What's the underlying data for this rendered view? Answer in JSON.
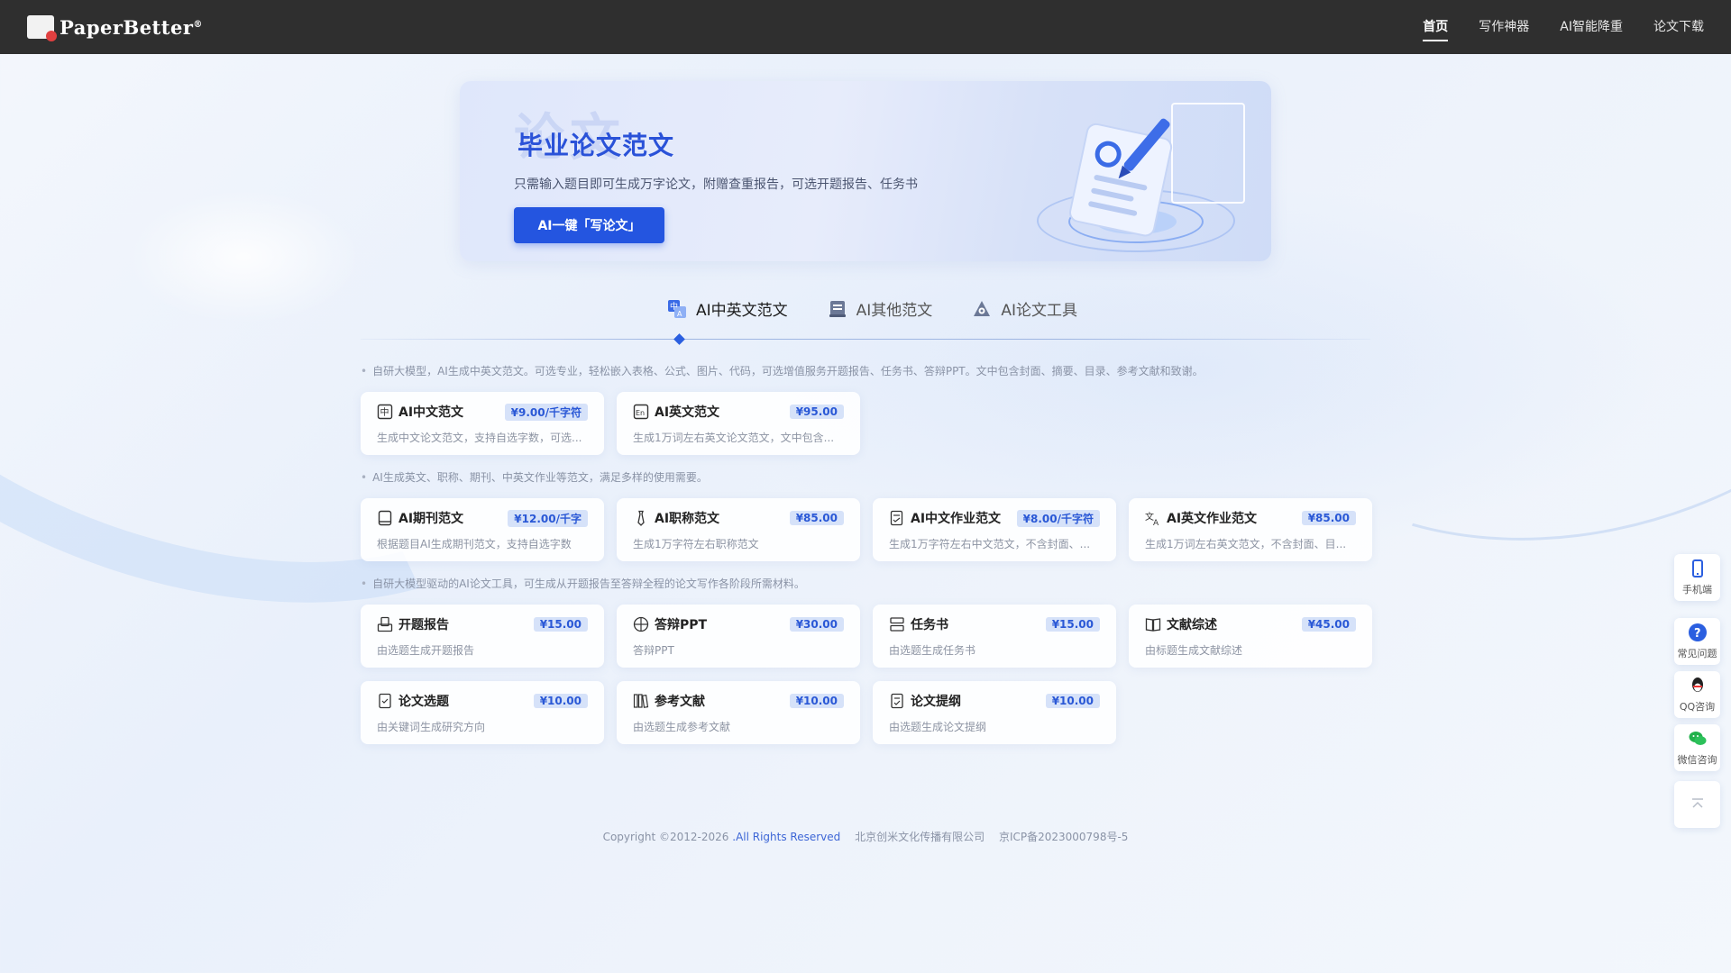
{
  "brand": {
    "name": "PaperBetter",
    "reg": "®"
  },
  "nav": [
    {
      "label": "首页",
      "active": true
    },
    {
      "label": "写作神器"
    },
    {
      "label": "AI智能降重"
    },
    {
      "label": "论文下载"
    }
  ],
  "banner": {
    "bg_text": "论文",
    "title": "毕业论文范文",
    "subtitle": "只需输入题目即可生成万字论文，附赠查重报告，可选开题报告、任务书",
    "button": "AI一键「写论文」"
  },
  "tabs": [
    {
      "label": "AI中英文范文",
      "icon": "cn-en-icon",
      "active": true
    },
    {
      "label": "AI其他范文",
      "icon": "document-stack-icon"
    },
    {
      "label": "AI论文工具",
      "icon": "tools-icon"
    }
  ],
  "sections": [
    {
      "note": "自研大模型，AI生成中英文范文。可选专业，轻松嵌入表格、公式、图片、代码，可选增值服务开题报告、任务书、答辩PPT。文中包含封面、摘要、目录、参考文献和致谢。",
      "cards": [
        {
          "title": "AI中文范文",
          "price": "¥9.00/千字符",
          "desc": "生成中文论文范文，支持自选字数，可选...",
          "icon": "zh-icon"
        },
        {
          "title": "AI英文范文",
          "price": "¥95.00",
          "desc": "生成1万词左右英文论文范文，文中包含...",
          "icon": "en-icon"
        }
      ]
    },
    {
      "note": "AI生成英文、职称、期刊、中英文作业等范文，满足多样的使用需要。",
      "cards": [
        {
          "title": "AI期刊范文",
          "price": "¥12.00/千字",
          "desc": "根据题目AI生成期刊范文，支持自选字数",
          "icon": "journal-icon"
        },
        {
          "title": "AI职称范文",
          "price": "¥85.00",
          "desc": "生成1万字符左右职称范文",
          "icon": "tie-icon"
        },
        {
          "title": "AI中文作业范文",
          "price": "¥8.00/千字符",
          "desc": "生成1万字符左右中文范文，不含封面、...",
          "icon": "homework-icon"
        },
        {
          "title": "AI英文作业范文",
          "price": "¥85.00",
          "desc": "生成1万词左右英文范文，不含封面、目...",
          "icon": "translate-icon"
        }
      ]
    },
    {
      "note": "自研大模型驱动的AI论文工具，可生成从开题报告至答辩全程的论文写作各阶段所需材料。",
      "cards": [
        {
          "title": "开题报告",
          "price": "¥15.00",
          "desc": "由选题生成开题报告",
          "icon": "report-icon"
        },
        {
          "title": "答辩PPT",
          "price": "¥30.00",
          "desc": "答辩PPT",
          "icon": "ppt-icon"
        },
        {
          "title": "任务书",
          "price": "¥15.00",
          "desc": "由选题生成任务书",
          "icon": "task-icon"
        },
        {
          "title": "文献综述",
          "price": "¥45.00",
          "desc": "由标题生成文献综述",
          "icon": "book-icon"
        },
        {
          "title": "论文选题",
          "price": "¥10.00",
          "desc": "由关键词生成研究方向",
          "icon": "topic-icon"
        },
        {
          "title": "参考文献",
          "price": "¥10.00",
          "desc": "由选题生成参考文献",
          "icon": "library-icon"
        },
        {
          "title": "论文提纲",
          "price": "¥10.00",
          "desc": "由选题生成论文提纲",
          "icon": "outline-icon"
        }
      ]
    }
  ],
  "footer": {
    "copyright": "Copyright ©2012-2026",
    "rights": ".All Rights Reserved",
    "company": "北京创米文化传播有限公司",
    "icp": "京ICP备2023000798号-5"
  },
  "side": [
    {
      "label": "手机端",
      "icon": "phone-icon"
    },
    {
      "label": "常见问题",
      "icon": "question-icon"
    },
    {
      "label": "QQ咨询",
      "icon": "qq-icon"
    },
    {
      "label": "微信咨询",
      "icon": "wechat-icon"
    },
    {
      "label": "",
      "icon": "back-to-top-icon"
    }
  ],
  "colors": {
    "accent": "#2455e0",
    "header": "#2f2f2f",
    "price_bg": "#d6e2f9"
  }
}
